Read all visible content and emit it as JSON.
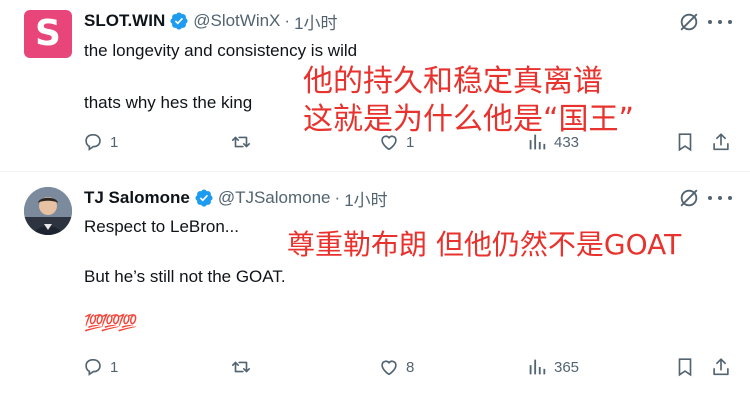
{
  "tweets": [
    {
      "name": "SLOT.WIN",
      "handle": "@SlotWinX",
      "separator": "·",
      "time": "1小时",
      "avatar_letter": "S",
      "lines": [
        "the longevity and consistency is wild",
        "thats why hes the king"
      ],
      "overlay": [
        "他的持久和稳定真离谱",
        "这就是为什么他是“国王”"
      ],
      "actions": {
        "reply": "1",
        "retweet": "",
        "like": "1",
        "views": "433"
      }
    },
    {
      "name": "TJ Salomone",
      "handle": "@TJSalomone",
      "separator": "·",
      "time": "1小时",
      "lines": [
        "Respect to LeBron...",
        "But he’s still not the GOAT.",
        "💯💯💯"
      ],
      "overlay": [
        "尊重勒布朗 但他仍然不是GOAT"
      ],
      "actions": {
        "reply": "1",
        "retweet": "",
        "like": "8",
        "views": "365"
      }
    }
  ],
  "icons": {
    "verified": "verified-badge-icon",
    "grok": "grok-icon",
    "more": "more-icon",
    "reply": "reply-icon",
    "retweet": "retweet-icon",
    "like": "like-icon",
    "views": "views-icon",
    "bookmark": "bookmark-icon",
    "share": "share-icon"
  },
  "colors": {
    "verified": "#1d9bf0",
    "overlay_text": "#e8322d",
    "slot_brand": "#e8457a",
    "secondary_text": "#536471"
  }
}
